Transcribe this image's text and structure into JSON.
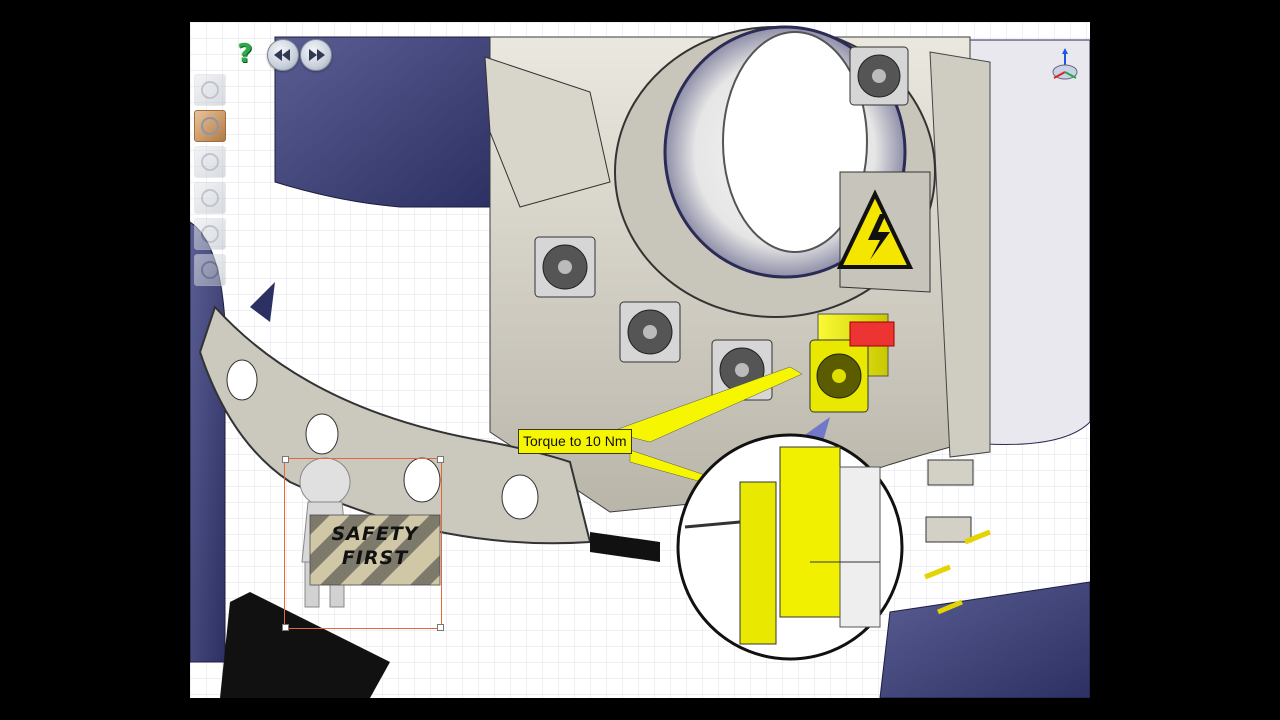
{
  "toolbar": {
    "help_icon": "help-icon",
    "prev_icon": "rewind-icon",
    "next_icon": "fast-forward-icon"
  },
  "sidebar": {
    "thumbnails": [
      {
        "name": "step-thumbnail-1",
        "active": false
      },
      {
        "name": "step-thumbnail-2",
        "active": true
      },
      {
        "name": "step-thumbnail-3",
        "active": false
      },
      {
        "name": "step-thumbnail-4",
        "active": false
      },
      {
        "name": "step-thumbnail-5",
        "active": false
      },
      {
        "name": "step-thumbnail-6",
        "active": false
      }
    ]
  },
  "callout": {
    "text": "Torque to 10 Nm",
    "color": "#f6f600"
  },
  "sign": {
    "line1": "SAFETY",
    "line2": "FIRST"
  },
  "colors": {
    "housing": "#d9d6cc",
    "covers": "#3f4276",
    "highlight": "#f2f200",
    "selection": "#e06a3c"
  },
  "nav_cube_icon": "orientation-triad-icon"
}
